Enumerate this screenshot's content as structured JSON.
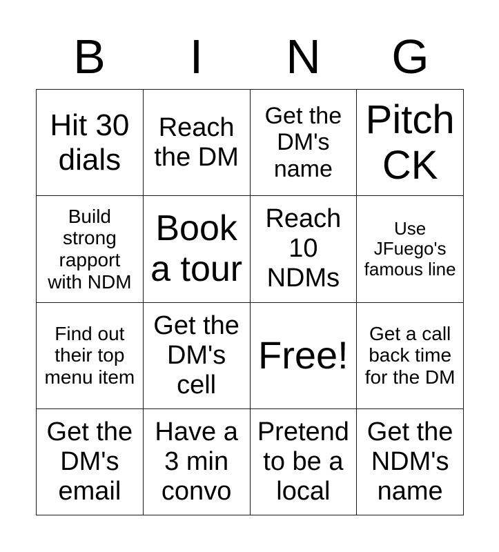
{
  "card": {
    "title": "BING",
    "columns": 4,
    "rows": 4,
    "background_color": "#ffffff",
    "border_color": "#1a1a1a",
    "text_color": "#000000"
  },
  "header": {
    "letters": [
      {
        "label": "B"
      },
      {
        "label": "I"
      },
      {
        "label": "N"
      },
      {
        "label": "G"
      }
    ]
  },
  "grid": {
    "cells": [
      {
        "text": "Hit 30 dials",
        "size": "fs-lg",
        "free": false
      },
      {
        "text": "Reach the DM",
        "size": "fs-md",
        "free": false
      },
      {
        "text": "Get the DM's name",
        "size": "fs-sm",
        "free": false
      },
      {
        "text": "Pitch CK",
        "size": "fs-xxl",
        "free": false
      },
      {
        "text": "Build strong rapport with NDM",
        "size": "fs-xs",
        "free": false
      },
      {
        "text": "Book a tour",
        "size": "fs-xl",
        "free": false
      },
      {
        "text": "Reach 10 NDMs",
        "size": "fs-md",
        "free": false
      },
      {
        "text": "Use JFuego's famous line",
        "size": "fs-xxs",
        "free": false
      },
      {
        "text": "Find out their top menu item",
        "size": "fs-xs",
        "free": false
      },
      {
        "text": "Get the DM's cell",
        "size": "fs-md",
        "free": false
      },
      {
        "text": "Free!",
        "size": "fs-free",
        "free": true
      },
      {
        "text": "Get a call back time for the DM",
        "size": "fs-xs",
        "free": false
      },
      {
        "text": "Get the DM's email",
        "size": "fs-md",
        "free": false
      },
      {
        "text": "Have a 3 min convo",
        "size": "fs-md",
        "free": false
      },
      {
        "text": "Pretend to be a local",
        "size": "fs-md",
        "free": false
      },
      {
        "text": "Get the NDM's name",
        "size": "fs-md",
        "free": false
      }
    ]
  }
}
